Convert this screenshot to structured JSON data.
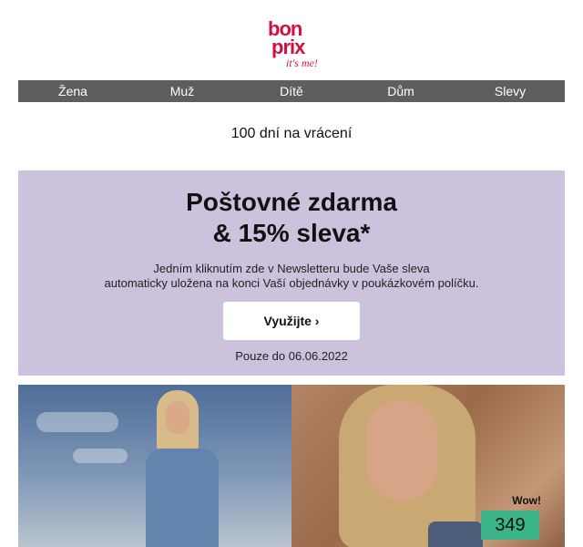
{
  "brand": {
    "name_line1": "bon",
    "name_line2": "prix",
    "tagline": "it's me!",
    "color": "#d1103f"
  },
  "nav": {
    "background": "#5e5e5e",
    "items": [
      {
        "label": "Žena"
      },
      {
        "label": "Muž"
      },
      {
        "label": "Dítě"
      },
      {
        "label": "Dům"
      },
      {
        "label": "Slevy"
      }
    ]
  },
  "returns_text": "100 dní na vrácení",
  "promo": {
    "background": "#ccc2dd",
    "headline_line1": "Poštovné zdarma",
    "headline_line2": "& 15% sleva*",
    "description_line1": "Jedním kliknutím zde v Newsletteru bude Vaše sleva",
    "description_line2": "automaticky uložena na konci Vaší objednávky v poukázkovém políčku.",
    "cta_label": "Využijte ›",
    "valid_until": "Pouze do 06.06.2022"
  },
  "hero": {
    "badge_text": "Wow!",
    "price": "349",
    "price_color": "#3cb489"
  }
}
